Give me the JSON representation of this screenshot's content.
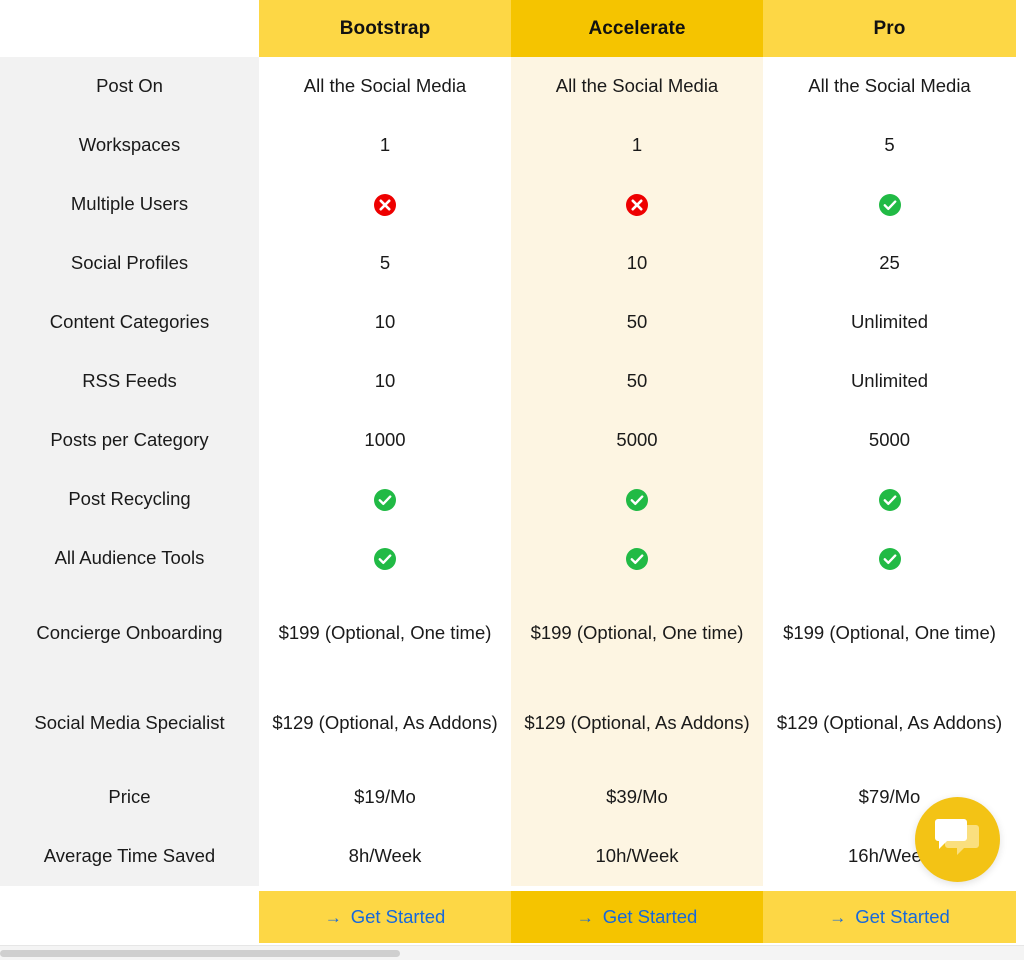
{
  "table": {
    "plans": [
      {
        "name": "Bootstrap",
        "highlight": false
      },
      {
        "name": "Accelerate",
        "highlight": true
      },
      {
        "name": "Pro",
        "highlight": false
      }
    ],
    "rows": [
      {
        "label": "Post On",
        "values": [
          "All the Social Media",
          "All the Social Media",
          "All the Social Media"
        ],
        "types": [
          "text",
          "text",
          "text"
        ]
      },
      {
        "label": "Workspaces",
        "values": [
          "1",
          "1",
          "5"
        ],
        "types": [
          "text",
          "text",
          "text"
        ]
      },
      {
        "label": "Multiple Users",
        "values": [
          "",
          "",
          ""
        ],
        "types": [
          "cross",
          "cross",
          "check"
        ]
      },
      {
        "label": "Social Profiles",
        "values": [
          "5",
          "10",
          "25"
        ],
        "types": [
          "text",
          "text",
          "text"
        ]
      },
      {
        "label": "Content Categories",
        "values": [
          "10",
          "50",
          "Unlimited"
        ],
        "types": [
          "text",
          "text",
          "text"
        ]
      },
      {
        "label": "RSS Feeds",
        "values": [
          "10",
          "50",
          "Unlimited"
        ],
        "types": [
          "text",
          "text",
          "text"
        ]
      },
      {
        "label": "Posts per Category",
        "values": [
          "1000",
          "5000",
          "5000"
        ],
        "types": [
          "text",
          "text",
          "text"
        ]
      },
      {
        "label": "Post Recycling",
        "values": [
          "",
          "",
          ""
        ],
        "types": [
          "check",
          "check",
          "check"
        ]
      },
      {
        "label": "All Audience Tools",
        "values": [
          "",
          "",
          ""
        ],
        "types": [
          "check",
          "check",
          "check"
        ]
      },
      {
        "label": "Concierge Onboarding",
        "values": [
          "$199 (Optional, One time)",
          "$199 (Optional, One time)",
          "$199 (Optional, One time)"
        ],
        "types": [
          "text",
          "text",
          "text"
        ],
        "tall": true
      },
      {
        "label": "Social Media Specialist",
        "values": [
          "$129 (Optional, As Addons)",
          "$129 (Optional, As Addons)",
          "$129 (Optional, As Addons)"
        ],
        "types": [
          "text",
          "text",
          "text"
        ],
        "tall": true
      },
      {
        "label": "Price",
        "values": [
          "$19/Mo",
          "$39/Mo",
          "$79/Mo"
        ],
        "types": [
          "text",
          "text",
          "text"
        ]
      },
      {
        "label": "Average Time Saved",
        "values": [
          "8h/Week",
          "10h/Week",
          "16h/Week"
        ],
        "types": [
          "text",
          "text",
          "text"
        ]
      }
    ],
    "cta": {
      "label": "Get Started",
      "arrow": "→"
    }
  },
  "icons": {
    "check_name": "green-check-icon",
    "cross_name": "red-cross-icon",
    "chat_name": "chat-bubble-icon"
  },
  "colors": {
    "header_plain": "#FDD745",
    "header_highlight": "#F5C400",
    "body_highlight": "#FDF5E2",
    "label_bg": "#F2F2F2",
    "check_green": "#21BA45",
    "cross_red": "#EE0000",
    "cta_blue": "#1668DC",
    "chat_yellow": "#F3C315"
  }
}
